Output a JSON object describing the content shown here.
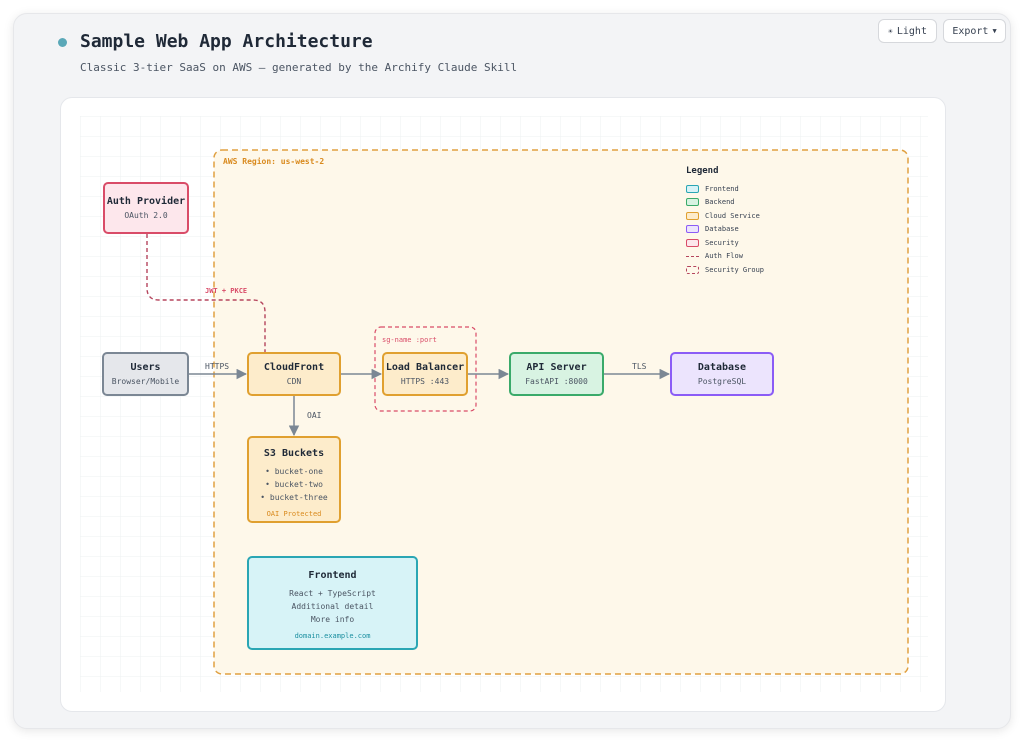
{
  "header": {
    "title": "Sample Web App Architecture",
    "subtitle": "Classic 3-tier SaaS on AWS — generated by the Archify Claude Skill",
    "theme_button": "Light",
    "export_button": "Export"
  },
  "colors": {
    "frontend": "#2aa6b4",
    "backend": "#3aaa6a",
    "cloud_service": "#e0a030",
    "database": "#8b5cf6",
    "security": "#d94c68",
    "neutral": "#7b8794"
  },
  "diagram": {
    "region": {
      "label": "AWS Region: us-west-2"
    },
    "security_group": {
      "label": "sg-name :port"
    },
    "nodes": {
      "auth": {
        "title": "Auth Provider",
        "subtitle": "OAuth 2.0"
      },
      "users": {
        "title": "Users",
        "subtitle": "Browser/Mobile"
      },
      "cloudfront": {
        "title": "CloudFront",
        "subtitle": "CDN"
      },
      "lb": {
        "title": "Load Balancer",
        "subtitle": "HTTPS :443"
      },
      "api": {
        "title": "API Server",
        "subtitle": "FastAPI :8000"
      },
      "db": {
        "title": "Database",
        "subtitle": "PostgreSQL"
      },
      "s3": {
        "title": "S3 Buckets",
        "items": [
          "• bucket-one",
          "• bucket-two",
          "• bucket-three"
        ],
        "note": "OAI Protected"
      },
      "frontend": {
        "title": "Frontend",
        "lines": [
          "React + TypeScript",
          "Additional detail",
          "More info"
        ],
        "link": "domain.example.com"
      }
    },
    "edges": {
      "users_cf": "HTTPS",
      "cf_s3": "OAI",
      "api_db": "TLS",
      "auth_cf": "JWT + PKCE"
    },
    "legend": {
      "title": "Legend",
      "items": [
        "Frontend",
        "Backend",
        "Cloud Service",
        "Database",
        "Security",
        "Auth Flow",
        "Security Group"
      ]
    }
  }
}
